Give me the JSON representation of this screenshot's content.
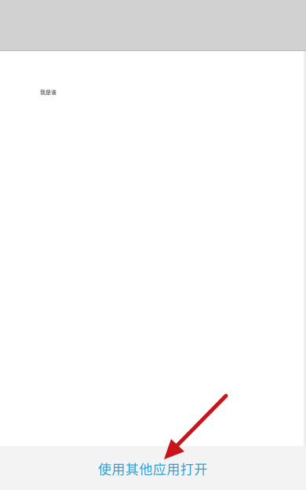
{
  "document": {
    "text": "我是谁"
  },
  "bottom_bar": {
    "open_with_label": "使用其他应用打开"
  },
  "colors": {
    "top_bar": "#d1d1d1",
    "bottom_bar": "#f3f3f3",
    "link": "#2f9fd4",
    "annotation_arrow": "#c8151b"
  }
}
